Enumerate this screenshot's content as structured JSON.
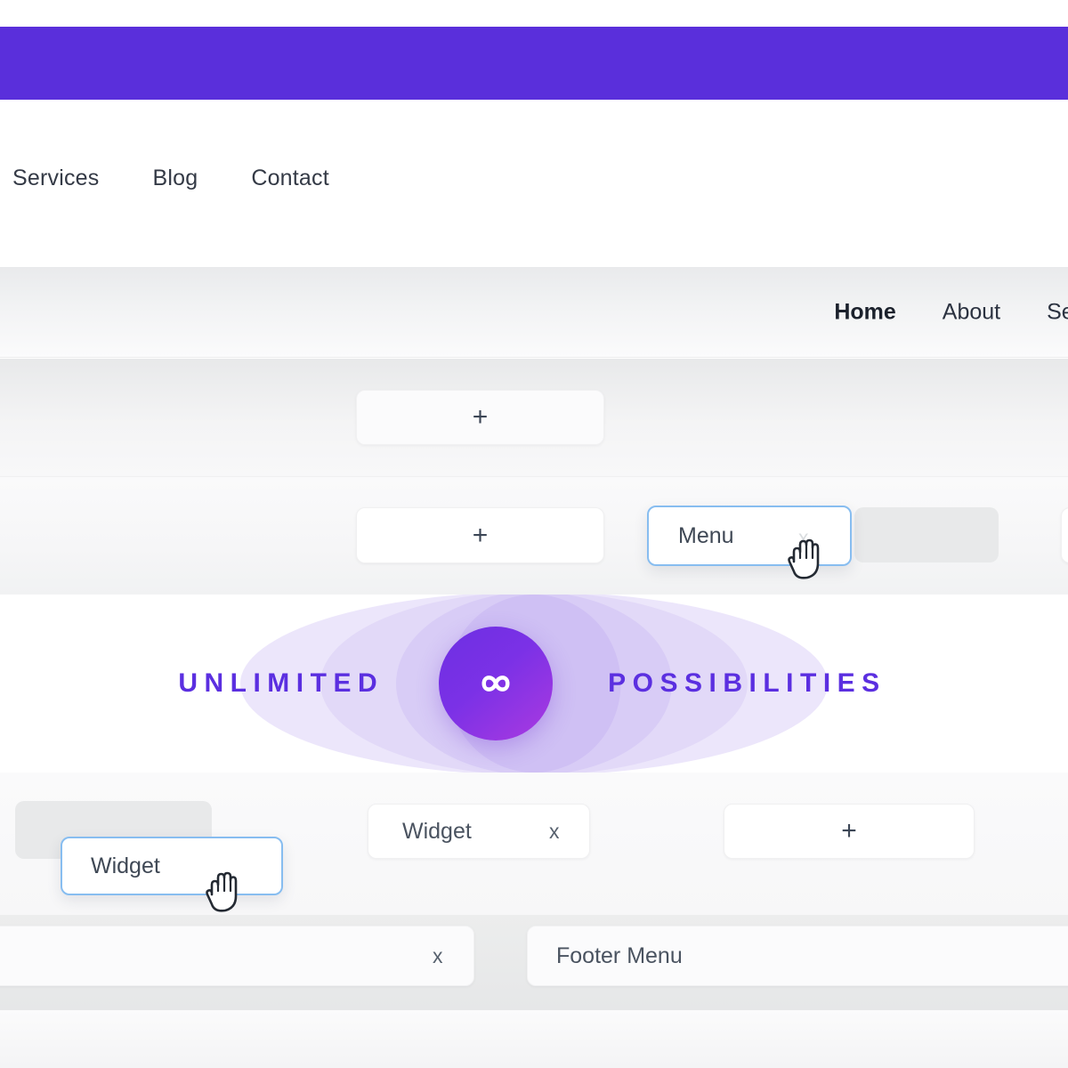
{
  "theme": {
    "brand_purple": "#5a2fdb",
    "hero_text_purple": "#5b2fe0",
    "drag_border_blue": "#87bdf0",
    "placeholder_grey": "#e8e9ea"
  },
  "top_nav": {
    "links": [
      {
        "label": "Services"
      },
      {
        "label": "Blog"
      },
      {
        "label": "Contact"
      }
    ]
  },
  "site_nav": {
    "links": [
      {
        "label": "Home",
        "active": true
      },
      {
        "label": "About",
        "active": false
      },
      {
        "label": "Services",
        "active": false
      }
    ]
  },
  "builder": {
    "row_a": {
      "add_button_label": "+"
    },
    "row_b": {
      "add_button_label": "+",
      "dragged_chip": {
        "label": "Menu",
        "remove_label": "x",
        "cursor": "grab-hand-cursor"
      }
    },
    "row_d": {
      "widget_card": {
        "label": "Widget",
        "remove_label": "x"
      },
      "add_button_label": "+",
      "dragged_chip": {
        "label": "Widget",
        "cursor": "grab-hand-cursor"
      }
    },
    "row_e": {
      "left_card_remove_label": "x",
      "footer_menu_label": "Footer Menu"
    }
  },
  "hero": {
    "left_word": "UNLIMITED",
    "right_word": "POSSIBILITIES",
    "badge_icon": "infinity-icon"
  }
}
